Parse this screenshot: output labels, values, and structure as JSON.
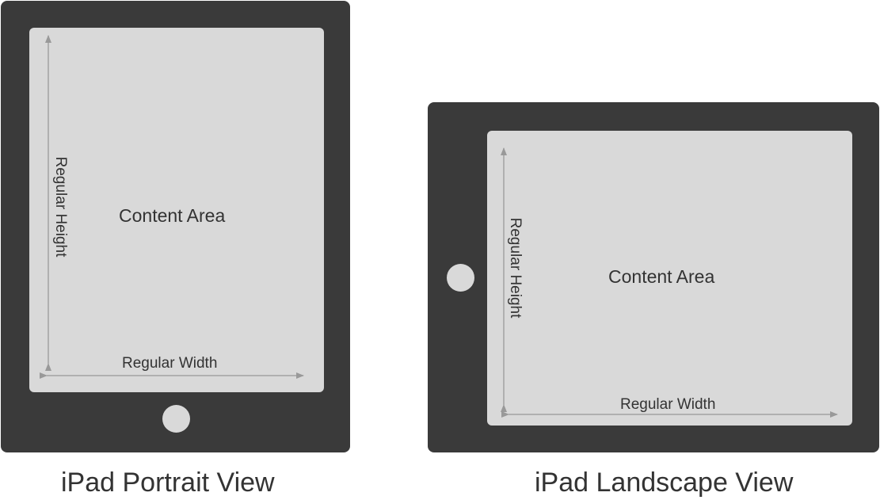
{
  "colors": {
    "device_body": "#3a3a3a",
    "screen": "#d9d9d9",
    "home_button": "#d9d9d9",
    "arrow": "#999999",
    "text": "#333333"
  },
  "portrait": {
    "content_label": "Content Area",
    "height_label": "Regular Height",
    "width_label": "Regular Width",
    "caption": "iPad Portrait View"
  },
  "landscape": {
    "content_label": "Content Area",
    "height_label": "Regular Height",
    "width_label": "Regular Width",
    "caption": "iPad Landscape View"
  }
}
